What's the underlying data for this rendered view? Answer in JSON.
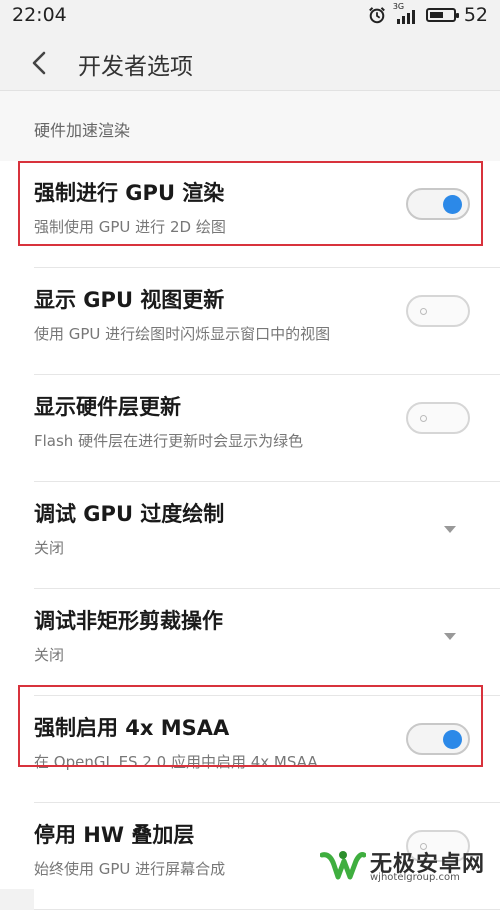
{
  "status_bar": {
    "time": "22:04",
    "network": "3G",
    "battery": "52"
  },
  "header": {
    "title": "开发者选项"
  },
  "section": {
    "title": "硬件加速渲染"
  },
  "rows": [
    {
      "title": "强制进行 GPU 渲染",
      "subtitle": "强制使用 GPU 进行 2D 绘图",
      "control": "toggle",
      "state": "on"
    },
    {
      "title": "显示 GPU 视图更新",
      "subtitle": "使用 GPU 进行绘图时闪烁显示窗口中的视图",
      "control": "toggle",
      "state": "off"
    },
    {
      "title": "显示硬件层更新",
      "subtitle": "Flash 硬件层在进行更新时会显示为绿色",
      "control": "toggle",
      "state": "off"
    },
    {
      "title": "调试 GPU 过度绘制",
      "subtitle": "关闭",
      "control": "dropdown"
    },
    {
      "title": "调试非矩形剪裁操作",
      "subtitle": "关闭",
      "control": "dropdown"
    },
    {
      "title": "强制启用 4x MSAA",
      "subtitle": "在 OpenGL ES 2.0 应用中启用 4x MSAA",
      "control": "toggle",
      "state": "on"
    },
    {
      "title": "停用 HW 叠加层",
      "subtitle": "始终使用 GPU 进行屏幕合成",
      "control": "toggle",
      "state": "off"
    }
  ],
  "watermark": {
    "name": "无极安卓网",
    "url": "wjhotelgroup.com"
  },
  "colors": {
    "accent": "#2c89e8",
    "highlight": "#d8323c"
  }
}
